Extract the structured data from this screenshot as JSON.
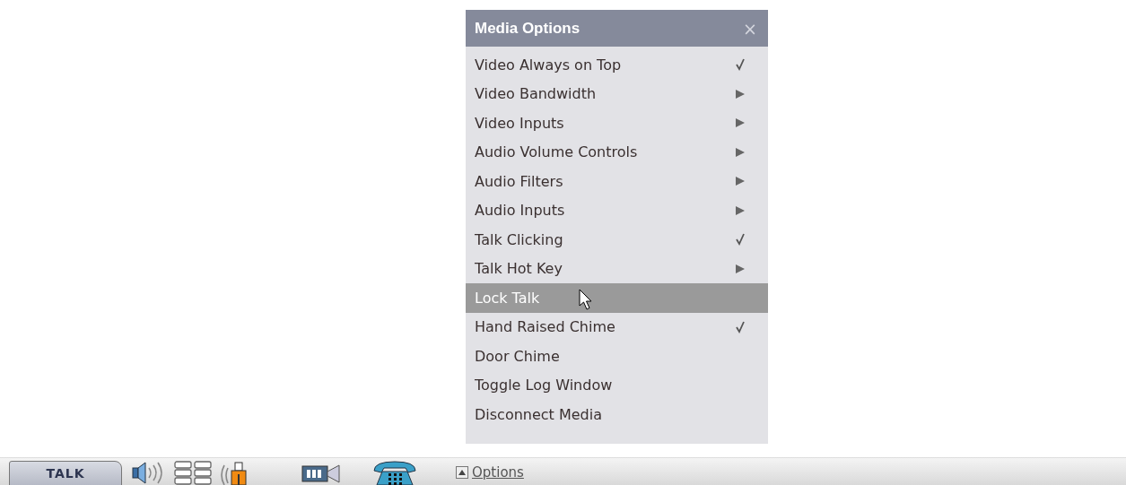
{
  "menu": {
    "title": "Media Options",
    "close": "×",
    "items": [
      {
        "label": "Video Always on Top",
        "kind": "check",
        "checked": true,
        "selected": false
      },
      {
        "label": "Video Bandwidth",
        "kind": "submenu",
        "selected": false
      },
      {
        "label": "Video Inputs",
        "kind": "submenu",
        "selected": false
      },
      {
        "label": "Audio Volume Controls",
        "kind": "submenu",
        "selected": false
      },
      {
        "label": "Audio Filters",
        "kind": "submenu",
        "selected": false
      },
      {
        "label": "Audio Inputs",
        "kind": "submenu",
        "selected": false
      },
      {
        "label": "Talk Clicking",
        "kind": "check",
        "checked": true,
        "selected": false
      },
      {
        "label": "Talk Hot Key",
        "kind": "submenu",
        "selected": false
      },
      {
        "label": "Lock Talk",
        "kind": "check",
        "checked": false,
        "selected": true
      },
      {
        "label": "Hand Raised Chime",
        "kind": "check",
        "checked": true,
        "selected": false
      },
      {
        "label": "Door Chime",
        "kind": "check",
        "checked": false,
        "selected": false
      },
      {
        "label": "Toggle Log Window",
        "kind": "plain",
        "selected": false
      },
      {
        "label": "Disconnect Media",
        "kind": "plain",
        "selected": false
      }
    ]
  },
  "toolbar": {
    "talk_button": "TALK",
    "options_link": "Options"
  }
}
